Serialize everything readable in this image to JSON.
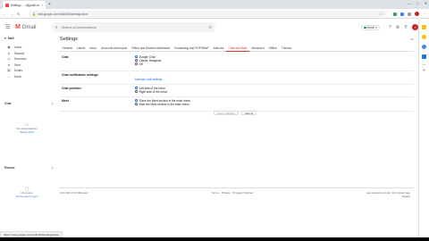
{
  "browser": {
    "tab_title": "Settings - ...@gmail.com",
    "tab_close": "×",
    "new_tab": "+",
    "window_controls": [
      "—",
      "□",
      "✕"
    ],
    "nav": [
      "←",
      "→",
      "↻"
    ],
    "url": "mail.google.com/mail/u/0/#settings/chat",
    "status_url": "https://mail.google.com/mail/u/0/#settings/chat"
  },
  "gmail": {
    "menu_icon": "☰",
    "logo_m": "M",
    "logo_text": "Gmail",
    "search_placeholder": "Search all conversations",
    "search_icon": "⌕",
    "search_options_icon": "☷",
    "status_label": "Active",
    "help_icon": "?",
    "settings_icon": "⚙",
    "apps_icon": "⠿",
    "avatar_letter": "J"
  },
  "sidebar": {
    "mail_label": "Mail",
    "items": [
      {
        "icon": "▣",
        "label": "Inbox"
      },
      {
        "icon": "★",
        "label": "Starred"
      },
      {
        "icon": "◷",
        "label": "Snoozed"
      },
      {
        "icon": "➤",
        "label": "Sent"
      },
      {
        "icon": "▤",
        "label": "Drafts"
      },
      {
        "icon": "⌄",
        "label": "More"
      }
    ],
    "chat_label": "Chat",
    "chat_empty": "No conversations",
    "chat_link": "Start a chat",
    "rooms_label": "Rooms",
    "rooms_empty": "No rooms",
    "rooms_link": "Find a room to join"
  },
  "settings": {
    "title": "Settings",
    "tools_icon": "▭",
    "tabs": [
      "General",
      "Labels",
      "Inbox",
      "Accounts and Import",
      "Filters and Blocked Addresses",
      "Forwarding and POP/IMAP",
      "Add-ons",
      "Chat and Meet",
      "Advanced",
      "Offline",
      "Themes"
    ],
    "active_tab": "Chat and Meet",
    "rows": [
      {
        "label": "Chat",
        "options": [
          "Google Chat",
          "Classic Hangouts",
          "Off"
        ],
        "selected": 0
      },
      {
        "label": "Chat notification settings",
        "link": "Manage chat settings"
      },
      {
        "label": "Chat position",
        "options": [
          "Left side of the inbox",
          "Right side of the inbox"
        ],
        "selected": 0
      },
      {
        "label": "Meet",
        "options": [
          "Show the Meet section in the main menu",
          "Hide the Meet section in the main menu"
        ],
        "selected": 0
      }
    ],
    "save_button": "Save Changes",
    "cancel_button": "Cancel"
  },
  "footer": {
    "storage": "0.01 GB of 15 GB used",
    "links": "Terms · Privacy · Program Policies",
    "activity": "Last account activity: 10 minutes ago",
    "details": "Details"
  },
  "colors": {
    "accent": "#1a73e8",
    "gmail_red": "#ea4335",
    "active_tab": "#d93025"
  }
}
